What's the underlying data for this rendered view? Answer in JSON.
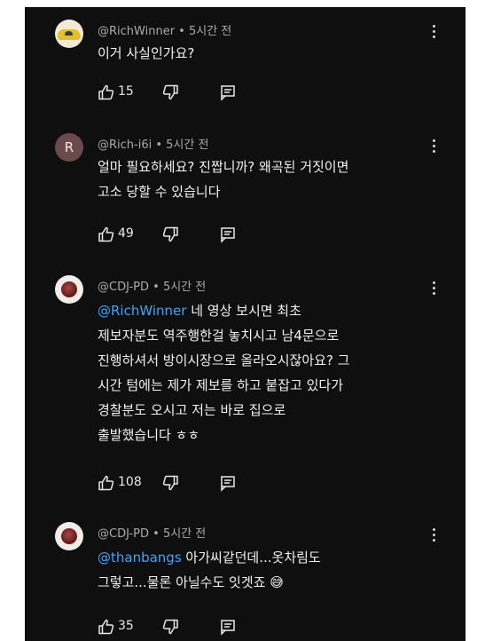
{
  "comments": [
    {
      "author": "@RichWinner",
      "time": "5시간 전",
      "mention": "",
      "text": "이거 사실인가요?",
      "likes": "15",
      "avatar": "sports-car-avatar"
    },
    {
      "author": "@Rich-i6i",
      "time": "5시간 전",
      "mention": "",
      "text": "얼마 필요하세요? 진짭니까? 왜곡된 거짓이면\n고소 당할 수 있습니다",
      "likes": "49",
      "avatar_letter": "R"
    },
    {
      "author": "@CDJ-PD",
      "time": "5시간 전",
      "mention": "@RichWinner",
      "text": " 네 영상 보시면 최초\n제보자분도 역주행한걸 놓치시고 남4문으로\n진행하셔서 방이시장으로 올라오시잖아요? 그\n시간 텀에는 제가 제보를 하고 붙잡고 있다가\n경찰분도 오시고 저는 바로 집으로\n출발했습니다 ㅎㅎ",
      "likes": "108",
      "avatar": "red-circle-avatar"
    },
    {
      "author": "@CDJ-PD",
      "time": "5시간 전",
      "mention": "@thanbangs",
      "text": " 아가씨같던데...옷차림도\n그렇고...물론 아닐수도 잇겟죠 😅",
      "likes": "35",
      "avatar": "red-circle-avatar"
    }
  ],
  "separator": " • "
}
